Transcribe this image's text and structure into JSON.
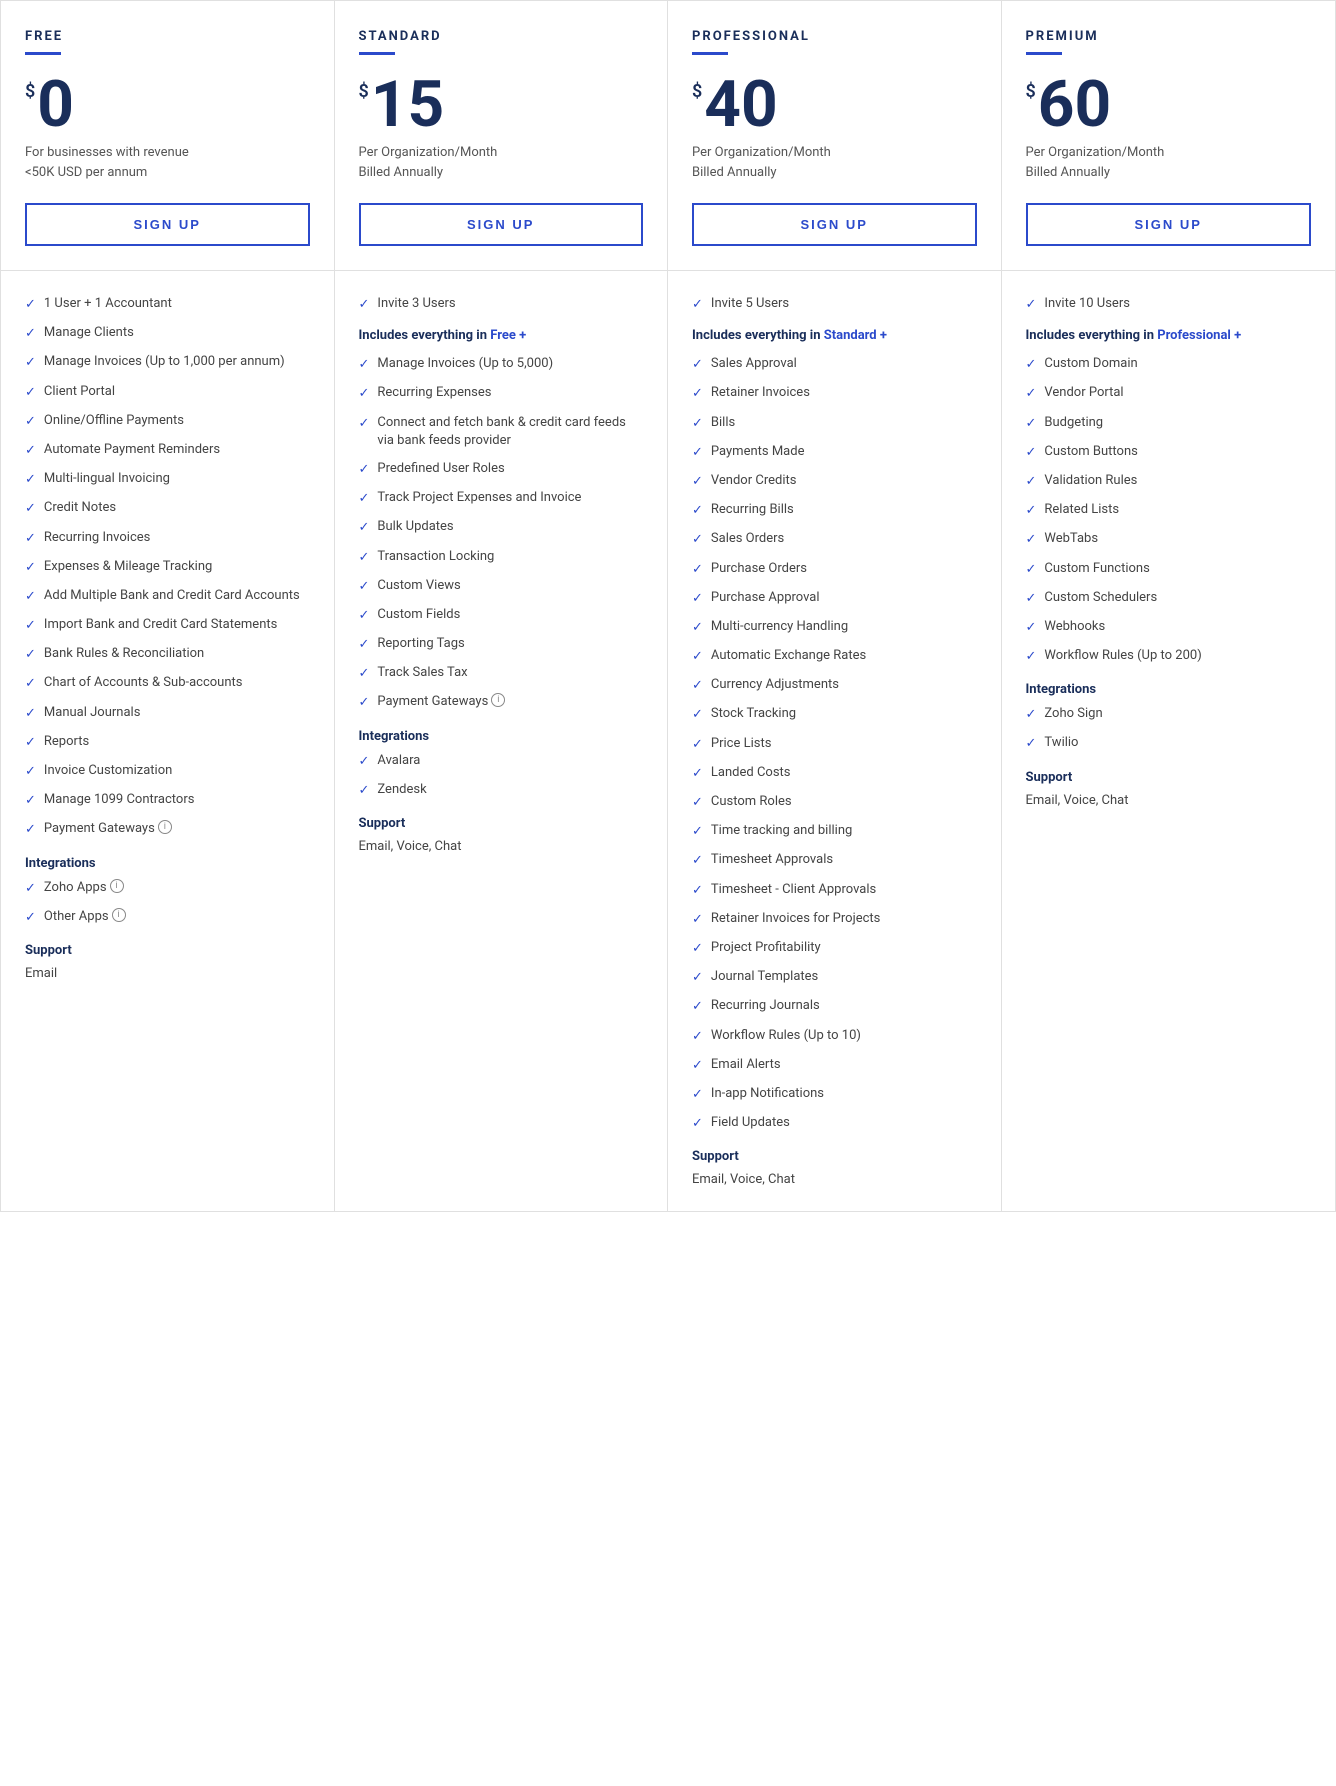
{
  "plans": [
    {
      "id": "free",
      "name": "FREE",
      "currency": "$",
      "amount": "0",
      "billing_line1": "For businesses with revenue",
      "billing_line2": "<50K USD per annum",
      "signup_label": "SIGN UP",
      "features": [
        {
          "text": "1 User + 1 Accountant",
          "info": false
        },
        {
          "text": "Manage Clients",
          "info": false
        },
        {
          "text": "Manage Invoices (Up to 1,000 per annum)",
          "info": false
        },
        {
          "text": "Client Portal",
          "info": false
        },
        {
          "text": "Online/Offline Payments",
          "info": false
        },
        {
          "text": "Automate Payment Reminders",
          "info": false
        },
        {
          "text": "Multi-lingual Invoicing",
          "info": false
        },
        {
          "text": "Credit Notes",
          "info": false
        },
        {
          "text": "Recurring Invoices",
          "info": false
        },
        {
          "text": "Expenses & Mileage Tracking",
          "info": false
        },
        {
          "text": "Add Multiple Bank and Credit Card Accounts",
          "info": false
        },
        {
          "text": "Import Bank and Credit Card Statements",
          "info": false
        },
        {
          "text": "Bank Rules & Reconciliation",
          "info": false
        },
        {
          "text": "Chart of Accounts & Sub-accounts",
          "info": false
        },
        {
          "text": "Manual Journals",
          "info": false
        },
        {
          "text": "Reports",
          "info": false
        },
        {
          "text": "Invoice Customization",
          "info": false
        },
        {
          "text": "Manage 1099 Contractors",
          "info": false
        },
        {
          "text": "Payment Gateways",
          "info": true
        }
      ],
      "integrations_heading": "Integrations",
      "integrations": [
        {
          "text": "Zoho Apps",
          "info": true
        },
        {
          "text": "Other Apps",
          "info": true
        }
      ],
      "support_heading": "Support",
      "support_text": "Email",
      "includes": null
    },
    {
      "id": "standard",
      "name": "STANDARD",
      "currency": "$",
      "amount": "15",
      "billing_line1": "Per Organization/Month",
      "billing_line2": "Billed Annually",
      "signup_label": "SIGN UP",
      "includes": {
        "label": "Includes everything in",
        "link": "Free +"
      },
      "features_before_includes": [
        {
          "text": "Invite 3 Users",
          "info": false
        }
      ],
      "features": [
        {
          "text": "Manage Invoices (Up to 5,000)",
          "info": false
        },
        {
          "text": "Recurring Expenses",
          "info": false
        },
        {
          "text": "Connect and fetch bank & credit card feeds via bank feeds provider",
          "info": false
        },
        {
          "text": "Predefined User Roles",
          "info": false
        },
        {
          "text": "Track Project Expenses and Invoice",
          "info": false
        },
        {
          "text": "Bulk Updates",
          "info": false
        },
        {
          "text": "Transaction Locking",
          "info": false
        },
        {
          "text": "Custom Views",
          "info": false
        },
        {
          "text": "Custom Fields",
          "info": false
        },
        {
          "text": "Reporting Tags",
          "info": false
        },
        {
          "text": "Track Sales Tax",
          "info": false
        },
        {
          "text": "Payment Gateways",
          "info": true
        }
      ],
      "integrations_heading": "Integrations",
      "integrations": [
        {
          "text": "Avalara",
          "info": false
        },
        {
          "text": "Zendesk",
          "info": false
        }
      ],
      "support_heading": "Support",
      "support_text": "Email, Voice, Chat"
    },
    {
      "id": "professional",
      "name": "PROFESSIONAL",
      "currency": "$",
      "amount": "40",
      "billing_line1": "Per Organization/Month",
      "billing_line2": "Billed Annually",
      "signup_label": "SIGN UP",
      "includes": {
        "label": "Includes everything in",
        "link": "Standard +"
      },
      "features_before_includes": [
        {
          "text": "Invite 5 Users",
          "info": false
        }
      ],
      "features": [
        {
          "text": "Sales Approval",
          "info": false
        },
        {
          "text": "Retainer Invoices",
          "info": false
        },
        {
          "text": "Bills",
          "info": false
        },
        {
          "text": "Payments Made",
          "info": false
        },
        {
          "text": "Vendor Credits",
          "info": false
        },
        {
          "text": "Recurring Bills",
          "info": false
        },
        {
          "text": "Sales Orders",
          "info": false
        },
        {
          "text": "Purchase Orders",
          "info": false
        },
        {
          "text": "Purchase Approval",
          "info": false
        },
        {
          "text": "Multi-currency Handling",
          "info": false
        },
        {
          "text": "Automatic Exchange Rates",
          "info": false
        },
        {
          "text": "Currency Adjustments",
          "info": false
        },
        {
          "text": "Stock Tracking",
          "info": false
        },
        {
          "text": "Price Lists",
          "info": false
        },
        {
          "text": "Landed Costs",
          "info": false
        },
        {
          "text": "Custom Roles",
          "info": false
        },
        {
          "text": "Time tracking and billing",
          "info": false
        },
        {
          "text": "Timesheet Approvals",
          "info": false
        },
        {
          "text": "Timesheet - Client Approvals",
          "info": false
        },
        {
          "text": "Retainer Invoices for Projects",
          "info": false
        },
        {
          "text": "Project Profitability",
          "info": false
        },
        {
          "text": "Journal Templates",
          "info": false
        },
        {
          "text": "Recurring Journals",
          "info": false
        },
        {
          "text": "Workflow Rules (Up to 10)",
          "info": false
        },
        {
          "text": "Email Alerts",
          "info": false
        },
        {
          "text": "In-app Notifications",
          "info": false
        },
        {
          "text": "Field Updates",
          "info": false
        }
      ],
      "integrations_heading": null,
      "integrations": [],
      "support_heading": "Support",
      "support_text": "Email, Voice, Chat"
    },
    {
      "id": "premium",
      "name": "PREMIUM",
      "currency": "$",
      "amount": "60",
      "billing_line1": "Per Organization/Month",
      "billing_line2": "Billed Annually",
      "signup_label": "SIGN UP",
      "includes": {
        "label": "Includes everything in",
        "link": "Professional +"
      },
      "features_before_includes": [
        {
          "text": "Invite 10 Users",
          "info": false
        }
      ],
      "features": [
        {
          "text": "Custom Domain",
          "info": false
        },
        {
          "text": "Vendor Portal",
          "info": false
        },
        {
          "text": "Budgeting",
          "info": false
        },
        {
          "text": "Custom Buttons",
          "info": false
        },
        {
          "text": "Validation Rules",
          "info": false
        },
        {
          "text": "Related Lists",
          "info": false
        },
        {
          "text": "WebTabs",
          "info": false
        },
        {
          "text": "Custom Functions",
          "info": false
        },
        {
          "text": "Custom Schedulers",
          "info": false
        },
        {
          "text": "Webhooks",
          "info": false
        },
        {
          "text": "Workflow Rules (Up to 200)",
          "info": false
        }
      ],
      "integrations_heading": "Integrations",
      "integrations": [
        {
          "text": "Zoho Sign",
          "info": false
        },
        {
          "text": "Twilio",
          "info": false
        }
      ],
      "support_heading": "Support",
      "support_text": "Email, Voice, Chat"
    }
  ],
  "icons": {
    "check": "✓",
    "info": "i"
  }
}
